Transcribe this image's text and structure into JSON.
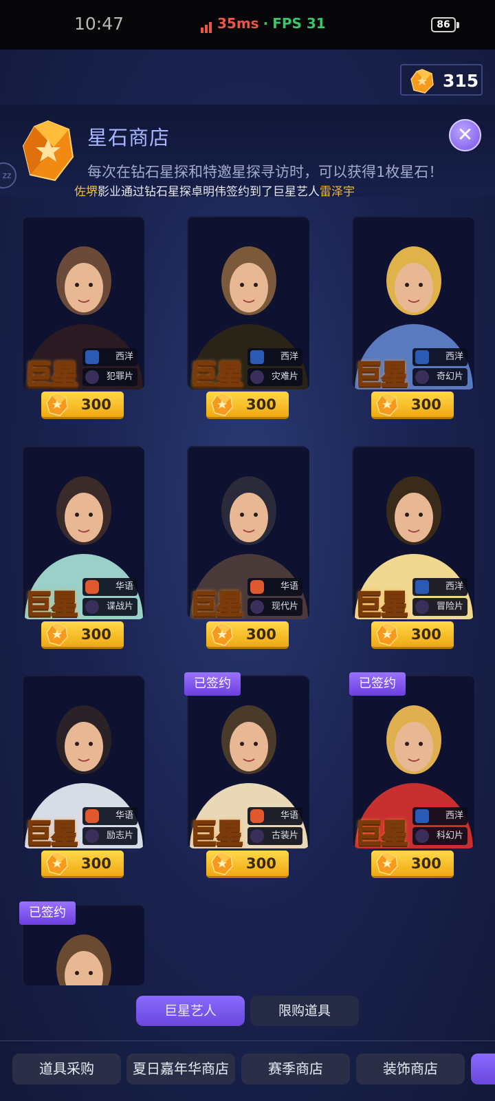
{
  "status_bar": {
    "time": "10:47",
    "ping": "35ms",
    "separator": "·",
    "fps": "FPS 31",
    "battery": "86"
  },
  "currency": {
    "amount": "315",
    "icon": "star-gem-icon"
  },
  "header": {
    "title": "星石商店",
    "close_icon": "close-x-icon",
    "description": "每次在钻石星探和特邀星探寻访时，可以获得1枚星石！",
    "side_badge": "zz",
    "ticker": {
      "studio": "佐堺",
      "middle": "影业通过钻石星探卓明伟签约到了巨星艺人",
      "artist": "雷泽宇"
    }
  },
  "cards": [
    {
      "label": "巨星",
      "region": "西洋",
      "genre": "犯罪片",
      "price": "300",
      "signed": ""
    },
    {
      "label": "巨星",
      "region": "西洋",
      "genre": "灾难片",
      "price": "300",
      "signed": ""
    },
    {
      "label": "巨星",
      "region": "西洋",
      "genre": "奇幻片",
      "price": "300",
      "signed": ""
    },
    {
      "label": "巨星",
      "region": "华语",
      "genre": "谍战片",
      "price": "300",
      "signed": ""
    },
    {
      "label": "巨星",
      "region": "华语",
      "genre": "现代片",
      "price": "300",
      "signed": ""
    },
    {
      "label": "巨星",
      "region": "西洋",
      "genre": "冒险片",
      "price": "300",
      "signed": ""
    },
    {
      "label": "巨星",
      "region": "华语",
      "genre": "励志片",
      "price": "300",
      "signed": ""
    },
    {
      "label": "巨星",
      "region": "华语",
      "genre": "古装片",
      "price": "300",
      "signed": "已签约"
    },
    {
      "label": "巨星",
      "region": "西洋",
      "genre": "科幻片",
      "price": "300",
      "signed": "已签约"
    },
    {
      "label": "",
      "region": "",
      "genre": "",
      "price": "",
      "signed": "已签约"
    }
  ],
  "tabs": [
    {
      "label": "巨星艺人",
      "active": true
    },
    {
      "label": "限购道具",
      "active": false
    }
  ],
  "bottom_nav": [
    {
      "label": "道具采购"
    },
    {
      "label": "夏日嘉年华商店"
    },
    {
      "label": "赛季商店"
    },
    {
      "label": "装饰商店"
    },
    {
      "label": ""
    }
  ],
  "colors": {
    "accent_purple": "#7a55e8",
    "gold": "#f0a912",
    "highlight_text": "#f2b833",
    "background": "#1b2452"
  }
}
